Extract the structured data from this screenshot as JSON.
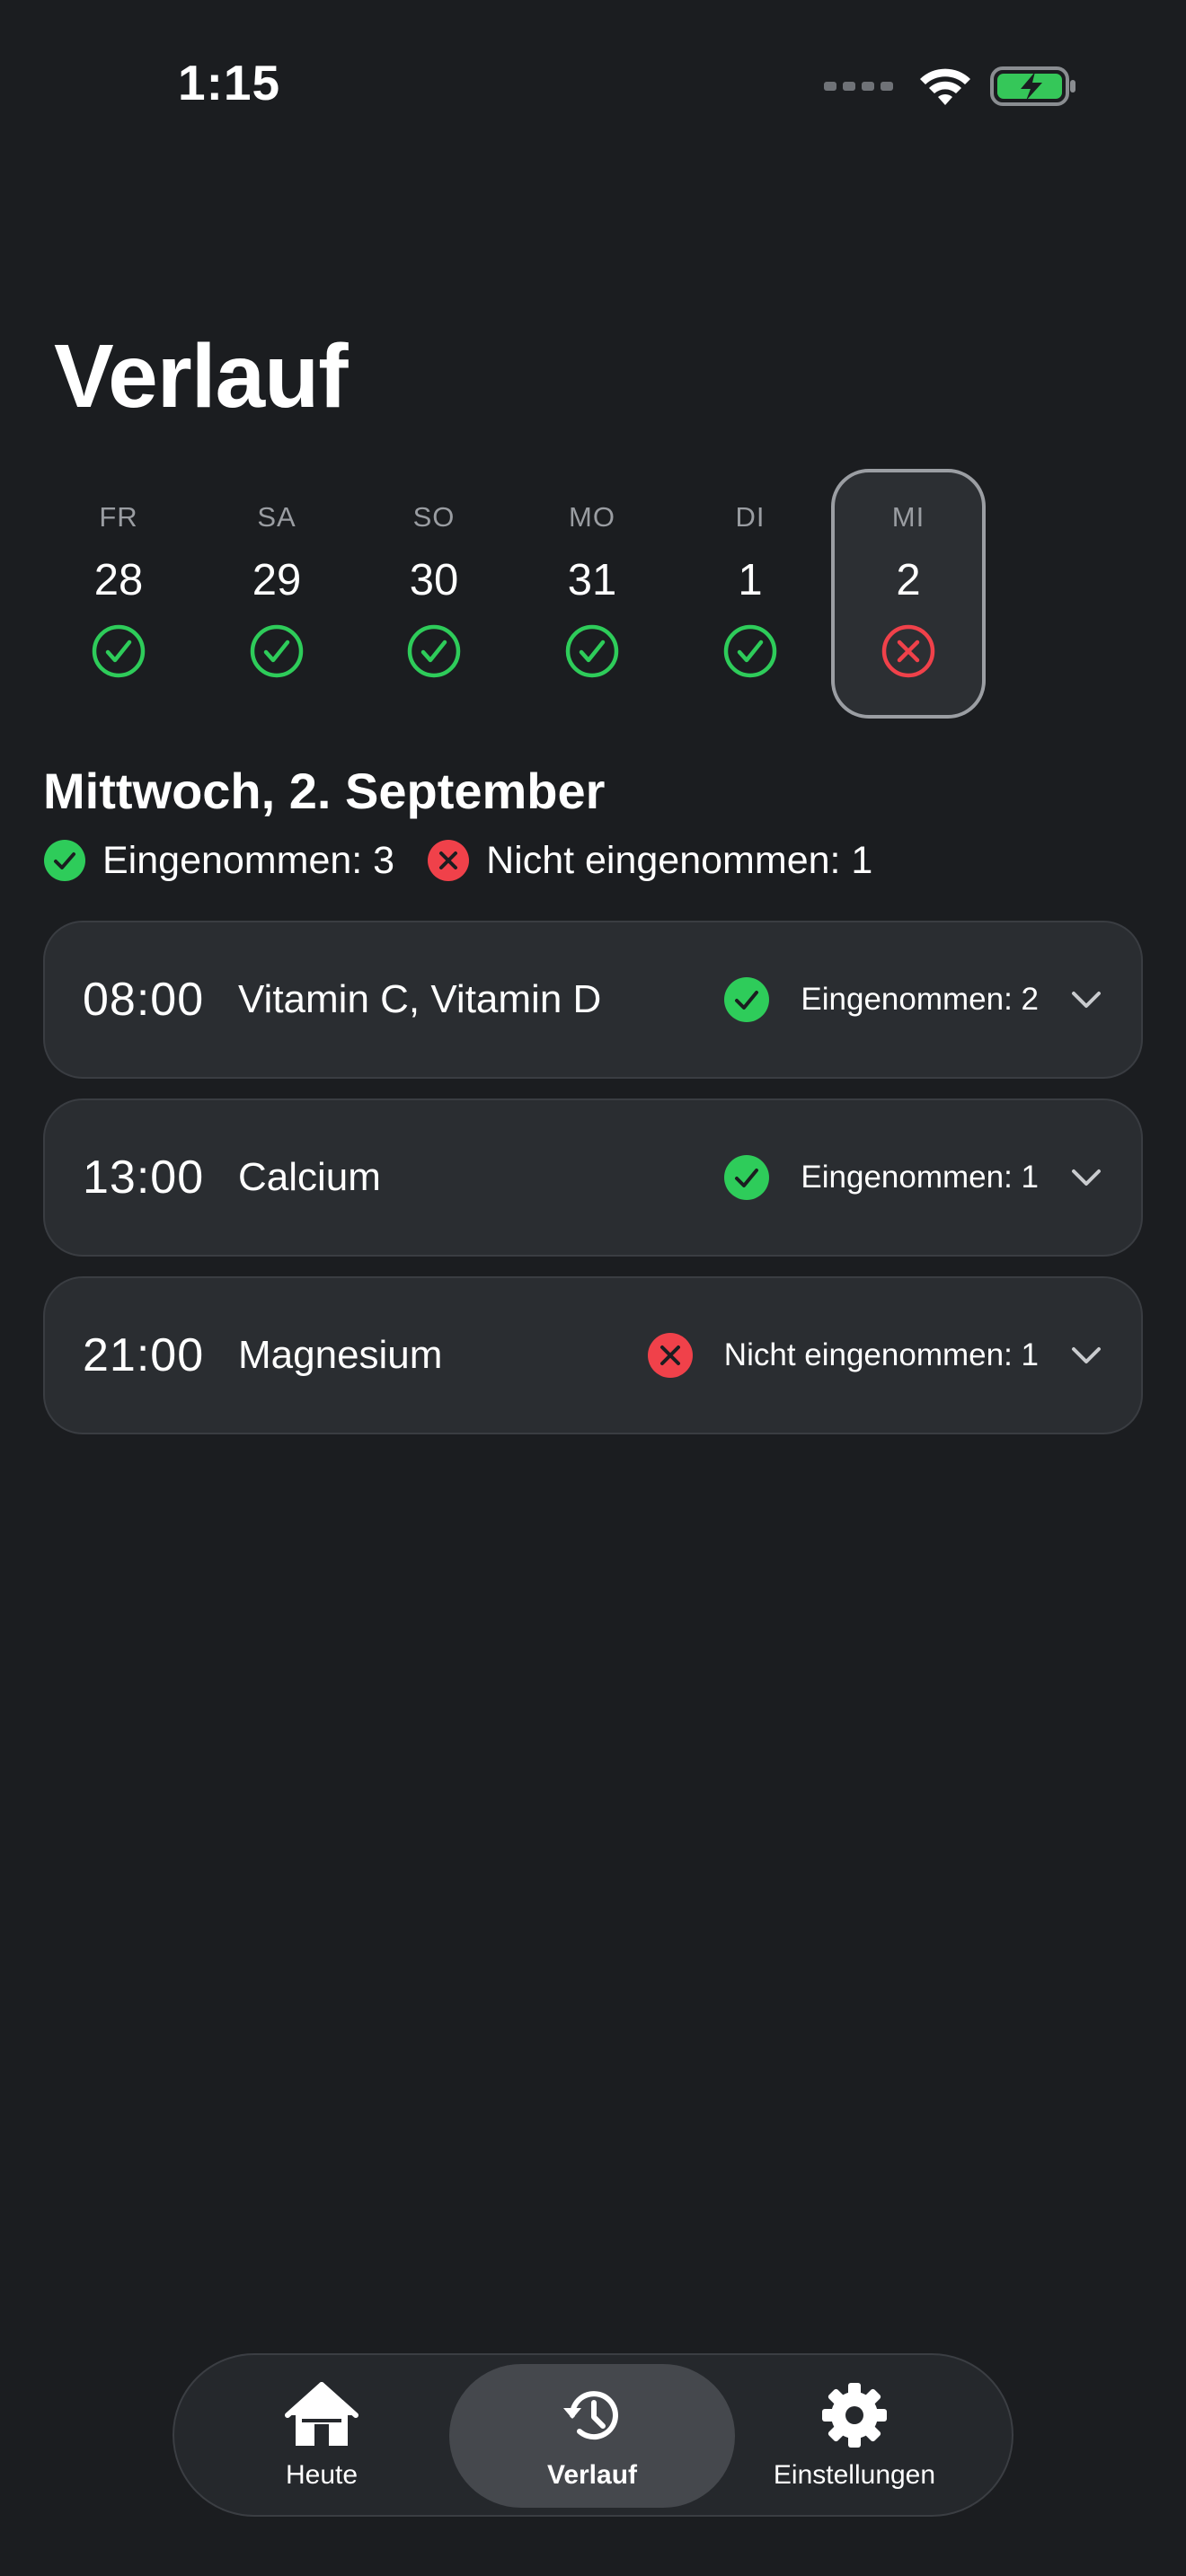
{
  "status_bar": {
    "time": "1:15"
  },
  "page": {
    "title": "Verlauf"
  },
  "days": [
    {
      "abbr": "FR",
      "num": "28",
      "state": "taken"
    },
    {
      "abbr": "SA",
      "num": "29",
      "state": "taken"
    },
    {
      "abbr": "SO",
      "num": "30",
      "state": "taken"
    },
    {
      "abbr": "MO",
      "num": "31",
      "state": "taken"
    },
    {
      "abbr": "DI",
      "num": "1",
      "state": "taken"
    },
    {
      "abbr": "MI",
      "num": "2",
      "state": "missed",
      "selected": true
    }
  ],
  "selected_date": {
    "title": "Mittwoch, 2. September",
    "taken_summary": "Eingenommen: 3",
    "missed_summary": "Nicht eingenommen: 1"
  },
  "doses": [
    {
      "time": "08:00",
      "name": "Vitamin C, Vitamin D",
      "status": "taken",
      "status_label": "Eingenommen: 2"
    },
    {
      "time": "13:00",
      "name": "Calcium",
      "status": "taken",
      "status_label": "Eingenommen: 1"
    },
    {
      "time": "21:00",
      "name": "Magnesium",
      "status": "missed",
      "status_label": "Nicht eingenommen: 1"
    }
  ],
  "tabs": [
    {
      "label": "Heute",
      "icon": "house-icon"
    },
    {
      "label": "Verlauf",
      "icon": "history-icon",
      "active": true
    },
    {
      "label": "Einstellungen",
      "icon": "gear-icon"
    }
  ],
  "colors": {
    "background": "#1b1d20",
    "card": "#2a2d31",
    "taken_green": "#2ecc5a",
    "missed_red": "#f0414a",
    "battery_green": "#35c759"
  }
}
